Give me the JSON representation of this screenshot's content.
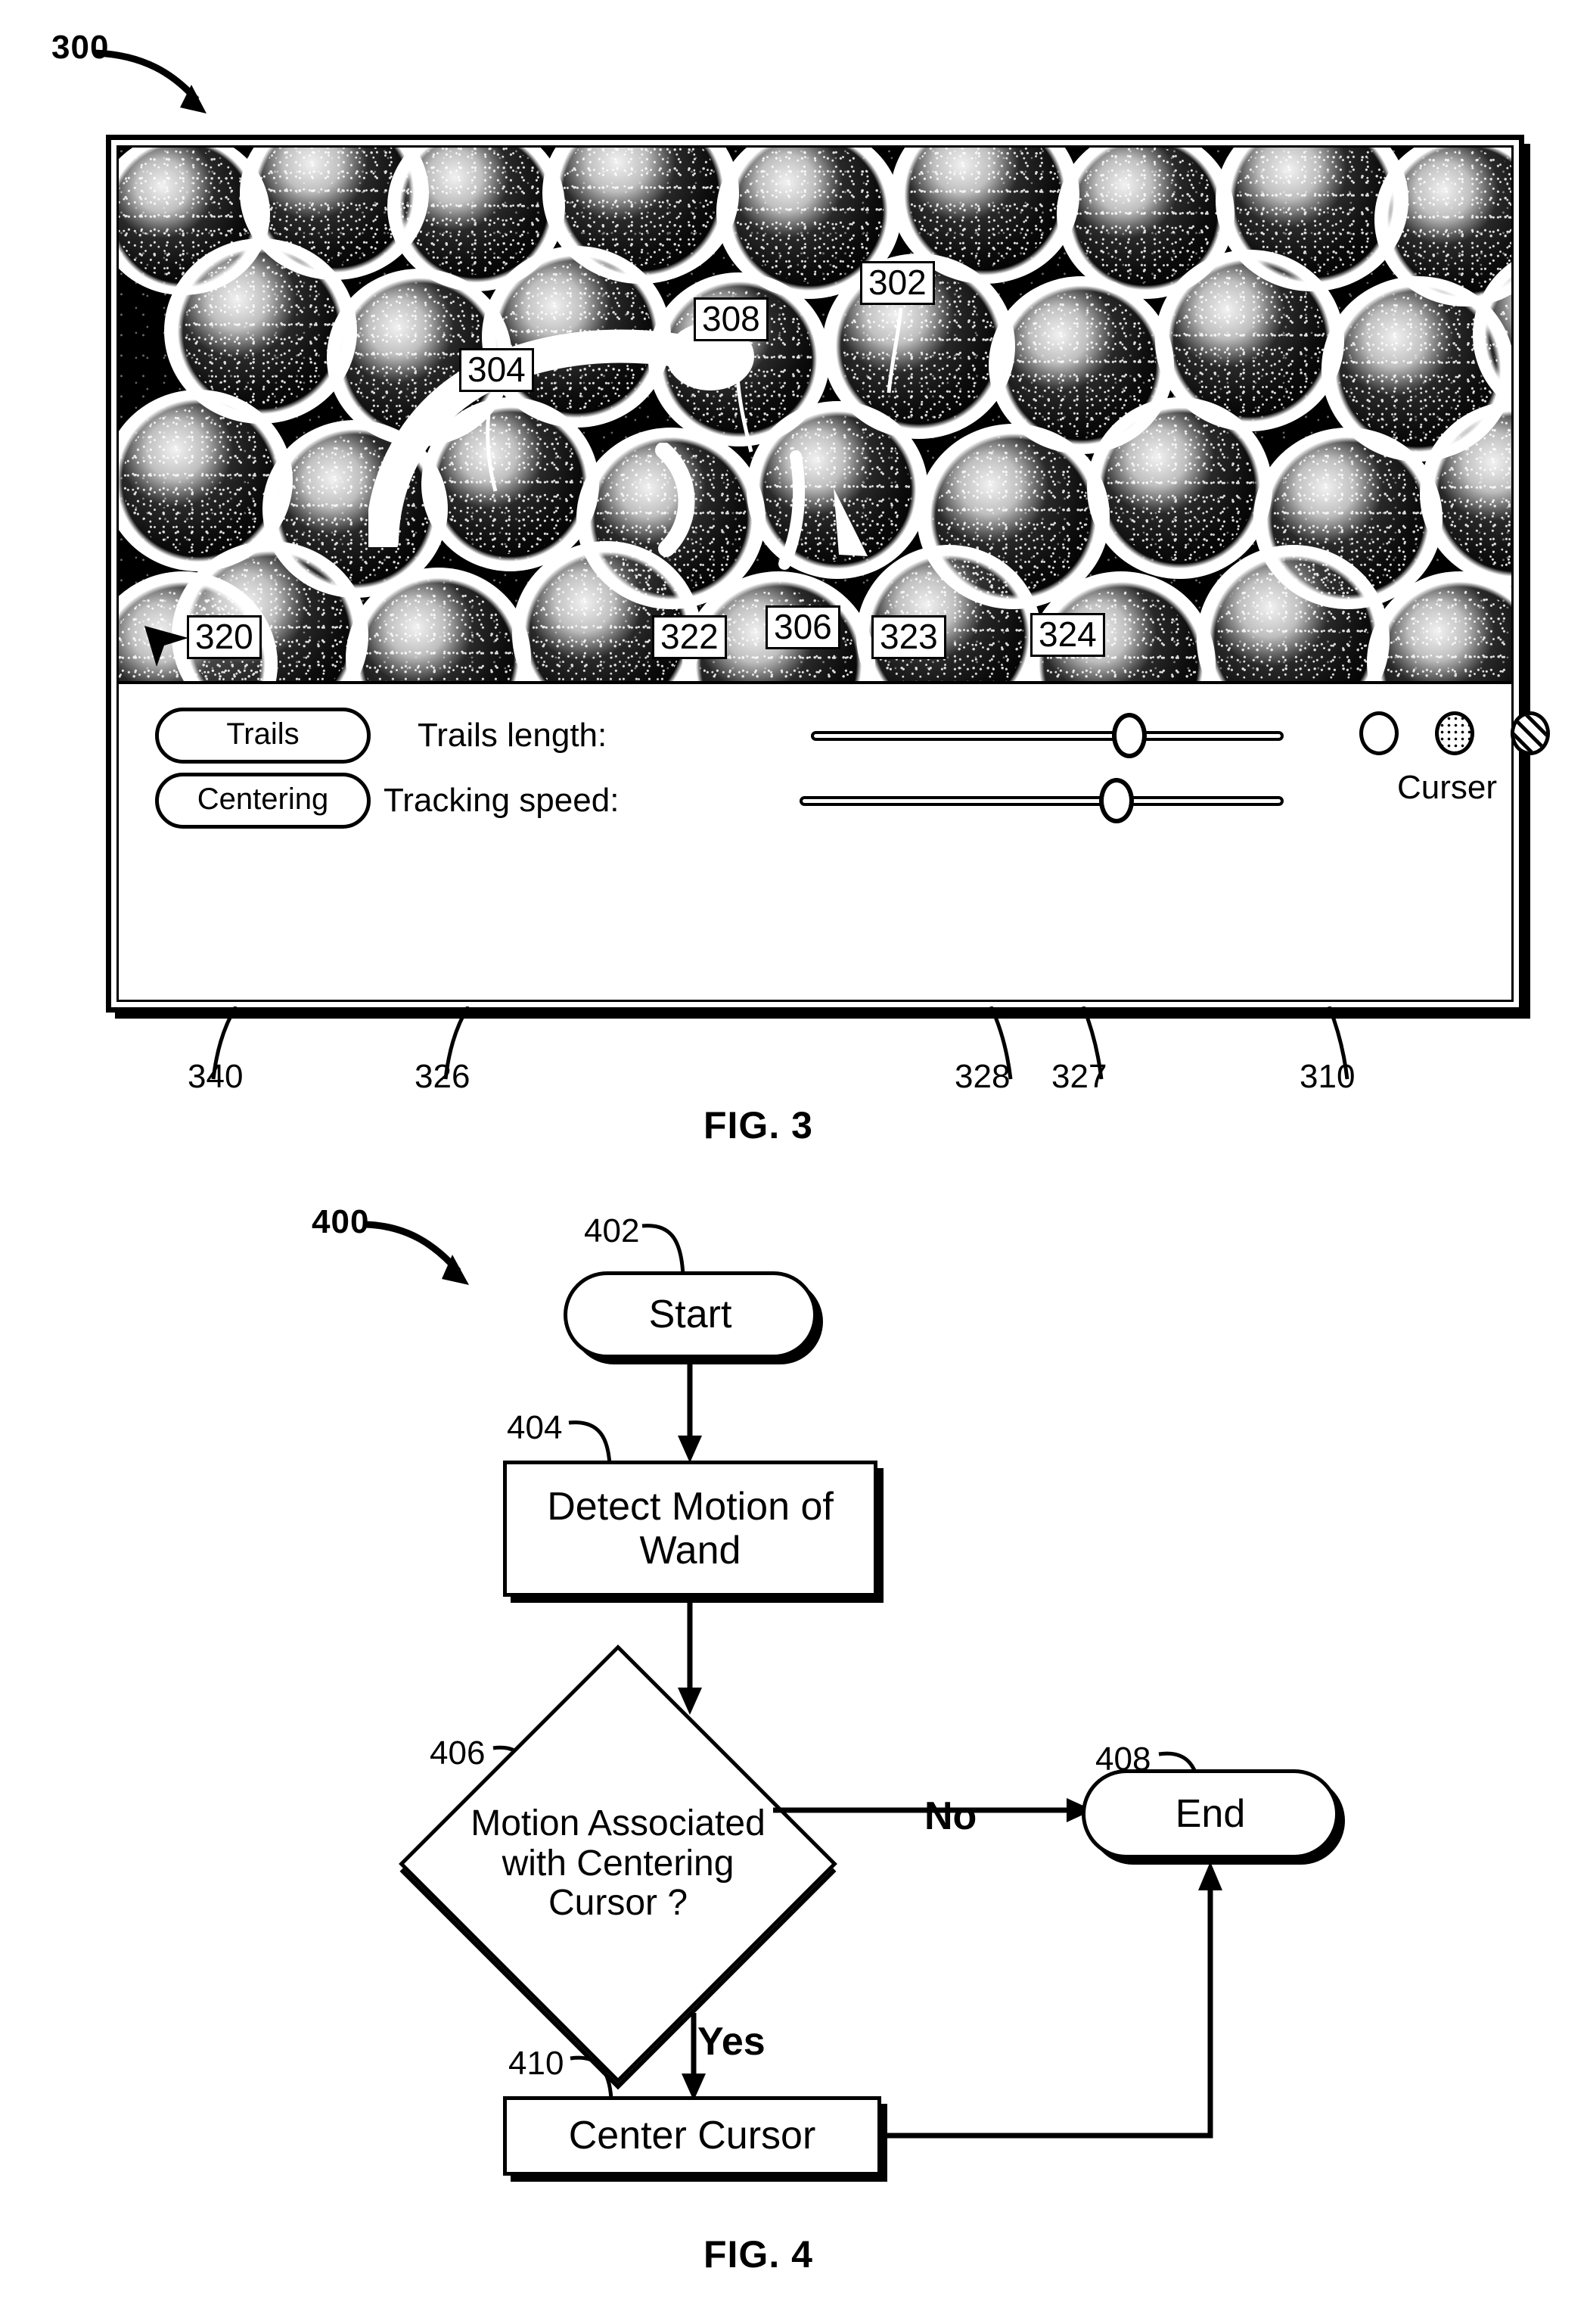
{
  "figure3": {
    "ref_label": "300",
    "caption": "FIG. 3",
    "image_refs": [
      {
        "id": "302",
        "text": "302"
      },
      {
        "id": "304",
        "text": "304"
      },
      {
        "id": "308",
        "text": "308"
      },
      {
        "id": "320",
        "text": "320"
      },
      {
        "id": "322",
        "text": "322"
      },
      {
        "id": "306",
        "text": "306"
      },
      {
        "id": "323",
        "text": "323"
      },
      {
        "id": "324",
        "text": "324"
      }
    ],
    "bottom_refs": [
      {
        "id": "340",
        "text": "340"
      },
      {
        "id": "326",
        "text": "326"
      },
      {
        "id": "328",
        "text": "328"
      },
      {
        "id": "327",
        "text": "327"
      },
      {
        "id": "310",
        "text": "310"
      }
    ],
    "controls": {
      "trails_button": "Trails",
      "centering_button": "Centering",
      "trails_length_label": "Trails length:",
      "tracking_speed_label": "Tracking speed:",
      "curser_label": "Curser",
      "trails_length_value": 66,
      "tracking_speed_value": 63,
      "cursor_styles": [
        "plain-circle",
        "dotted-circle",
        "hatched-circle"
      ]
    },
    "image_content": {
      "description": "microscopy-field-of-spherical-cells",
      "wand_trail": "white-comet-trail",
      "pointer": "mouse-pointer-arrow"
    }
  },
  "figure4": {
    "ref_label": "400",
    "caption": "FIG. 4",
    "nodes": [
      {
        "ref": "402",
        "type": "terminator",
        "label": "Start"
      },
      {
        "ref": "404",
        "type": "process",
        "label": "Detect Motion of Wand"
      },
      {
        "ref": "406",
        "type": "decision",
        "label": "Motion Associated with Centering Cursor ?"
      },
      {
        "ref": "408",
        "type": "terminator",
        "label": "End"
      },
      {
        "ref": "410",
        "type": "process",
        "label": "Center Cursor"
      }
    ],
    "branch_labels": {
      "no": "No",
      "yes": "Yes"
    }
  },
  "colors": {
    "ink": "#000000",
    "paper": "#ffffff"
  }
}
